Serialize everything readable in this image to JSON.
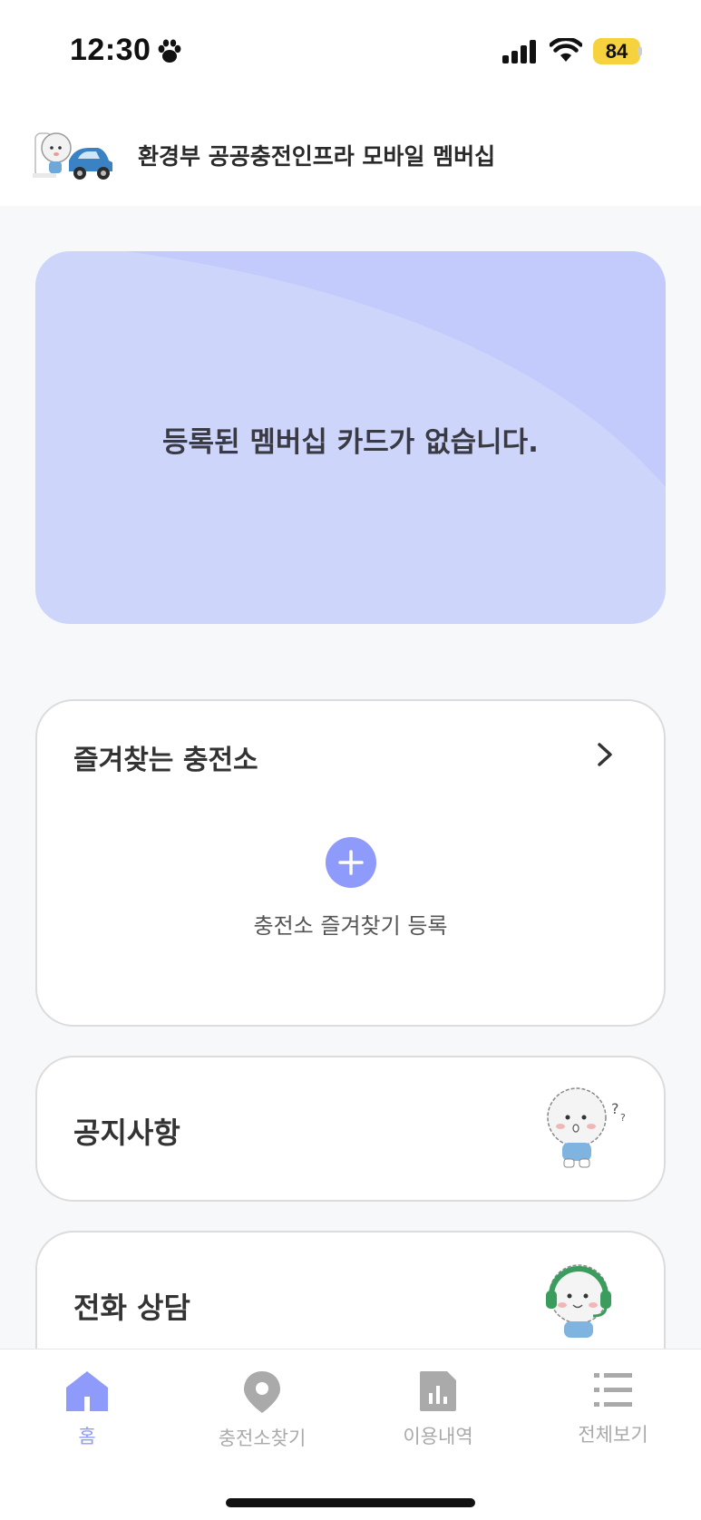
{
  "status_bar": {
    "time": "12:30",
    "battery": "84",
    "icons": [
      "paw-icon",
      "signal-icon",
      "wifi-icon",
      "battery-icon"
    ]
  },
  "header": {
    "title": "환경부 공공충전인프라 모바일 멤버십"
  },
  "membership_card": {
    "empty_message": "등록된 멤버십 카드가 없습니다."
  },
  "favorites": {
    "title": "즐겨찾는 충전소",
    "add_label": "충전소 즐겨찾기 등록"
  },
  "notice": {
    "title": "공지사항"
  },
  "phone": {
    "title": "전화 상담"
  },
  "bottom_nav": {
    "items": [
      {
        "label": "홈",
        "icon": "home-icon",
        "active": true
      },
      {
        "label": "충전소찾기",
        "icon": "location-pin-icon",
        "active": false
      },
      {
        "label": "이용내역",
        "icon": "bar-chart-icon",
        "active": false
      },
      {
        "label": "전체보기",
        "icon": "list-icon",
        "active": false
      }
    ]
  },
  "colors": {
    "accent": "#8f9bfa",
    "card_bg": "#cdd5fb",
    "card_shape": "#c2cbfb",
    "inactive": "#aaaaaa"
  }
}
